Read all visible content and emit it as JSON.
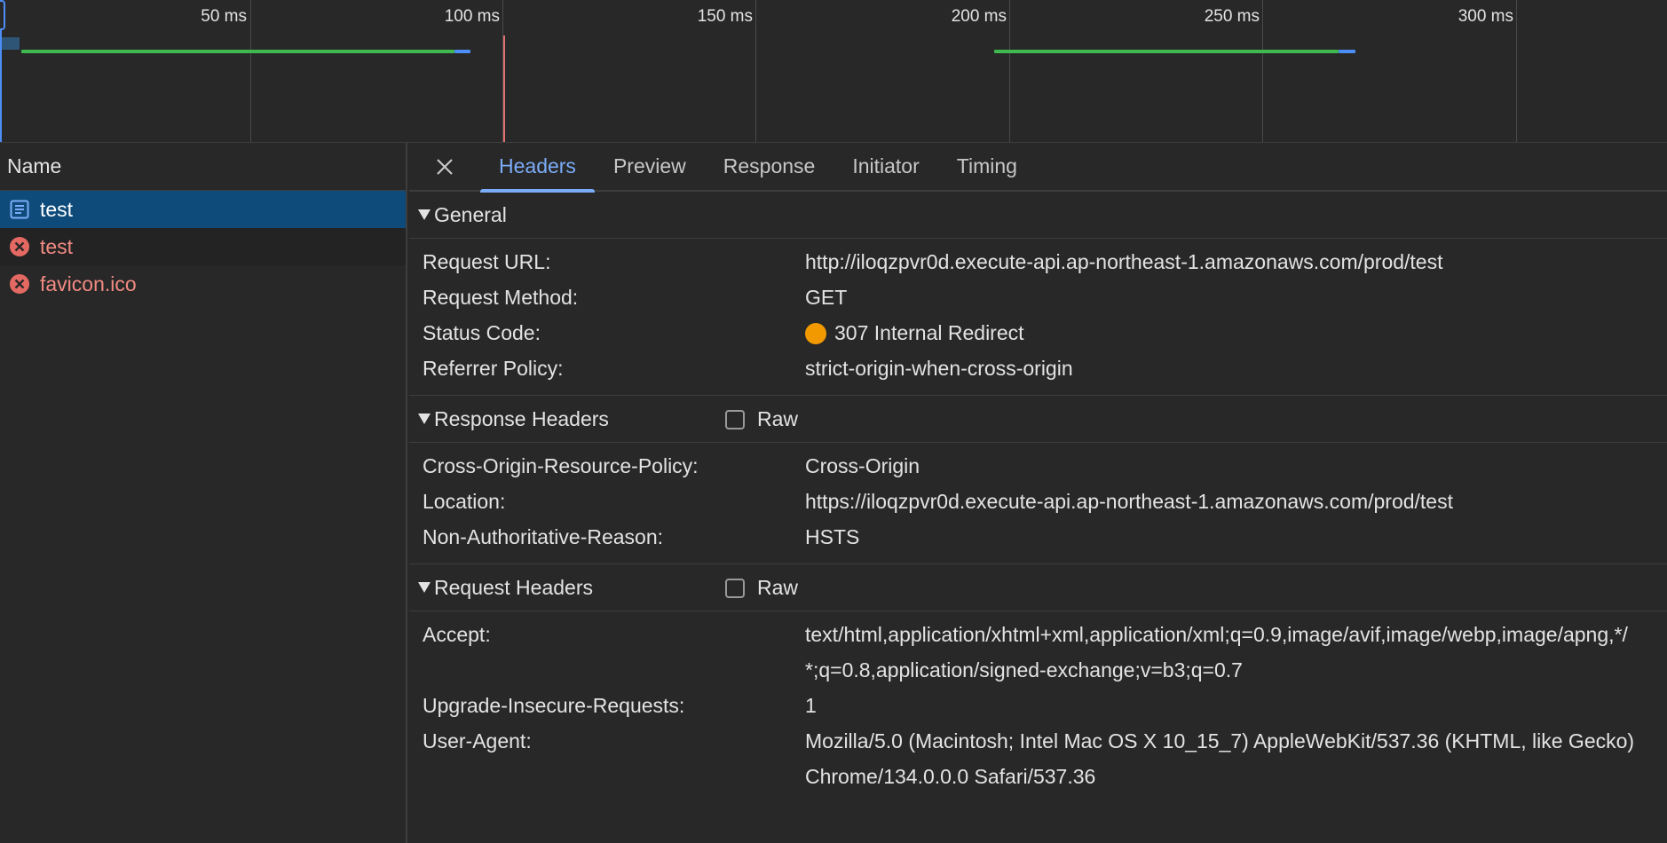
{
  "timeline": {
    "ticks": [
      "50 ms",
      "100 ms",
      "150 ms",
      "200 ms",
      "250 ms",
      "300 ms"
    ]
  },
  "name_column": {
    "header": "Name"
  },
  "requests": [
    {
      "name": "test",
      "status": "document"
    },
    {
      "name": "test",
      "status": "error"
    },
    {
      "name": "favicon.ico",
      "status": "error"
    }
  ],
  "tabs": [
    "Headers",
    "Preview",
    "Response",
    "Initiator",
    "Timing"
  ],
  "active_tab": "Headers",
  "general": {
    "title": "General",
    "rows": [
      {
        "key": "Request URL:",
        "value": "http://iloqzpvr0d.execute-api.ap-northeast-1.amazonaws.com/prod/test"
      },
      {
        "key": "Request Method:",
        "value": "GET"
      },
      {
        "key": "Status Code:",
        "value": "307 Internal Redirect"
      },
      {
        "key": "Referrer Policy:",
        "value": "strict-origin-when-cross-origin"
      }
    ]
  },
  "response_headers": {
    "title": "Response Headers",
    "raw_label": "Raw",
    "rows": [
      {
        "key": "Cross-Origin-Resource-Policy:",
        "value": "Cross-Origin"
      },
      {
        "key": "Location:",
        "value": "https://iloqzpvr0d.execute-api.ap-northeast-1.amazonaws.com/prod/test"
      },
      {
        "key": "Non-Authoritative-Reason:",
        "value": "HSTS"
      }
    ]
  },
  "request_headers": {
    "title": "Request Headers",
    "raw_label": "Raw",
    "rows": [
      {
        "key": "Accept:",
        "value": "text/html,application/xhtml+xml,application/xml;q=0.9,image/avif,image/webp,image/apng,*/*;q=0.8,application/signed-exchange;v=b3;q=0.7"
      },
      {
        "key": "Upgrade-Insecure-Requests:",
        "value": "1"
      },
      {
        "key": "User-Agent:",
        "value": "Mozilla/5.0 (Macintosh; Intel Mac OS X 10_15_7) AppleWebKit/537.36 (KHTML, like Gecko) Chrome/134.0.0.0 Safari/537.36"
      }
    ]
  },
  "colors": {
    "accent": "#7cacf8",
    "selected_row": "#0e4b7a",
    "error": "#f28b82",
    "status_warning": "#f29900",
    "bar_green": "#3fb950",
    "bar_blue": "#4c8df6"
  }
}
